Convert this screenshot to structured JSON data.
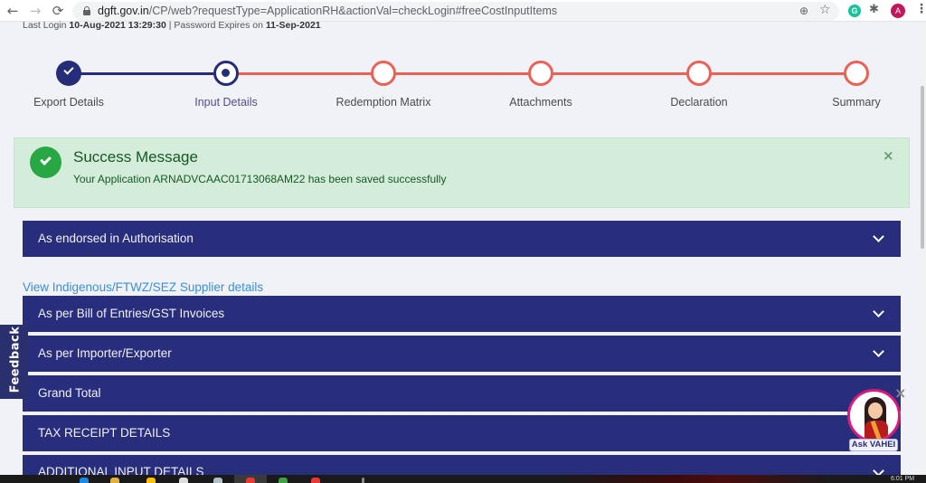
{
  "browser": {
    "url_domain": "dgft.gov.in",
    "url_path": "/CP/web?requestType=ApplicationRH&actionVal=checkLogin#freeCostInputItems",
    "profile_initial": "A",
    "grammarly_initial": "G",
    "icons": {
      "back": "←",
      "forward": "→",
      "reload": "⟳",
      "zoom": "⊕",
      "star": "☆",
      "puzzle": "✱",
      "menu": "⋮"
    }
  },
  "session": {
    "last_login_label": "Last Login",
    "last_login_value": "10-Aug-2021 13:29:30",
    "separator": "|",
    "password_expires_label": "Password Expires on",
    "password_expires_value": "11-Sep-2021"
  },
  "stepper": {
    "steps": [
      {
        "label": "Export Details",
        "status": "done"
      },
      {
        "label": "Input Details",
        "status": "current"
      },
      {
        "label": "Redemption Matrix",
        "status": "pending"
      },
      {
        "label": "Attachments",
        "status": "pending"
      },
      {
        "label": "Declaration",
        "status": "pending"
      },
      {
        "label": "Summary",
        "status": "pending"
      }
    ],
    "colors": {
      "done": "#262d78",
      "pending": "#ea6156"
    }
  },
  "alert": {
    "title": "Success Message",
    "message": "Your Application ARNADVCAAC01713068AM22 has been saved successfully",
    "close": "×"
  },
  "panels": [
    {
      "title": "As endorsed in Authorisation"
    },
    {
      "title": "As per Bill of Entries/GST Invoices"
    },
    {
      "title": "As per Importer/Exporter"
    },
    {
      "title": "Grand Total"
    },
    {
      "title": "TAX RECEIPT DETAILS"
    },
    {
      "title": "ADDITIONAL INPUT DETAILS"
    }
  ],
  "supplier_link": "View Indigenous/FTWZ/SEZ Supplier details",
  "feedback_label": "Feedback",
  "chatbot": {
    "label": "Ask VAHEI",
    "close": "×"
  },
  "taskbar": {
    "clock": "6:01 PM"
  },
  "theme": {
    "panel_bg": "#282e7b",
    "page_bg": "#f1f2f7",
    "alert_bg": "#d4edda",
    "link": "#3a8fd9"
  }
}
